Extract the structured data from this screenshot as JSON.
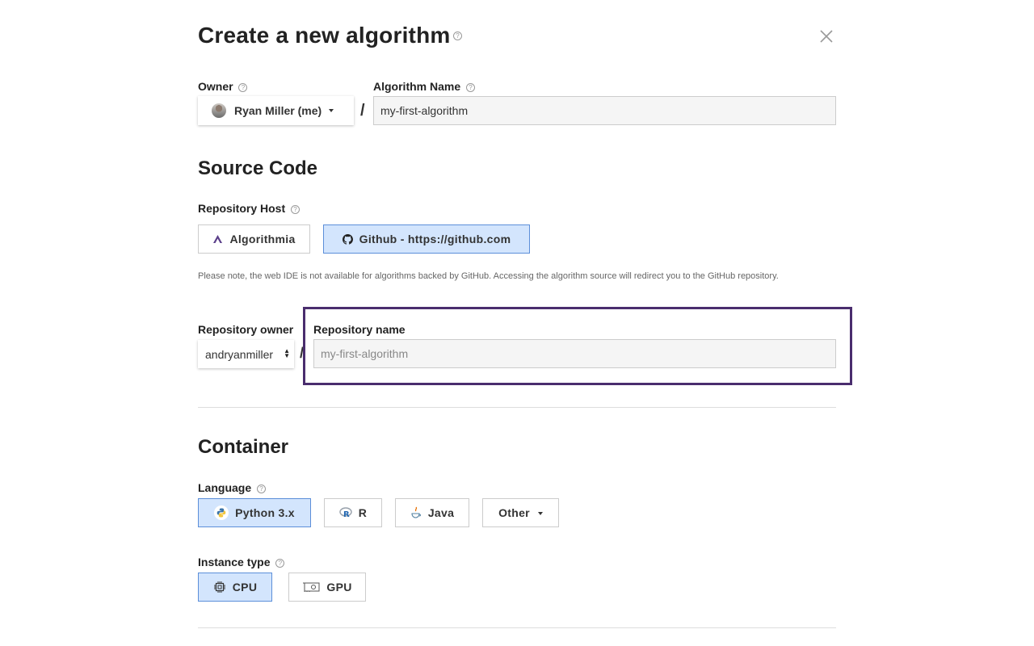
{
  "header": {
    "title": "Create a new algorithm",
    "help": "?",
    "close_glyph": "×"
  },
  "owner": {
    "label": "Owner",
    "help": "?",
    "value": "Ryan Miller (me)"
  },
  "separator": "/",
  "algorithm_name": {
    "label": "Algorithm Name",
    "help": "?",
    "value": "my-first-algorithm"
  },
  "source_code": {
    "heading": "Source Code",
    "repo_host": {
      "label": "Repository Host",
      "help": "?",
      "options": [
        {
          "label": "Algorithmia",
          "icon": "algorithmia-logo-icon",
          "selected": false
        },
        {
          "label": "Github - https://github.com",
          "icon": "github-icon",
          "selected": true
        }
      ]
    },
    "note": "Please note, the web IDE is not available for algorithms backed by GitHub. Accessing the algorithm source will redirect you to the GitHub repository.",
    "repo_owner": {
      "label": "Repository owner",
      "value": "andryanmiller"
    },
    "repo_name": {
      "label": "Repository name",
      "placeholder": "my-first-algorithm"
    }
  },
  "container": {
    "heading": "Container",
    "language": {
      "label": "Language",
      "help": "?",
      "options": [
        {
          "label": "Python 3.x",
          "icon": "python-icon",
          "selected": true
        },
        {
          "label": "R",
          "icon": "r-icon",
          "selected": false
        },
        {
          "label": "Java",
          "icon": "java-icon",
          "selected": false
        },
        {
          "label": "Other",
          "icon": "chevron-down-icon",
          "selected": false
        }
      ]
    },
    "instance_type": {
      "label": "Instance type",
      "help": "?",
      "options": [
        {
          "label": "CPU",
          "icon": "cpu-icon",
          "selected": true
        },
        {
          "label": "GPU",
          "icon": "gpu-icon",
          "selected": false
        }
      ]
    }
  },
  "colors": {
    "selected_bg": "#d3e5fd",
    "selected_border": "#5c8fd9",
    "highlight_border": "#4a2d6e"
  }
}
